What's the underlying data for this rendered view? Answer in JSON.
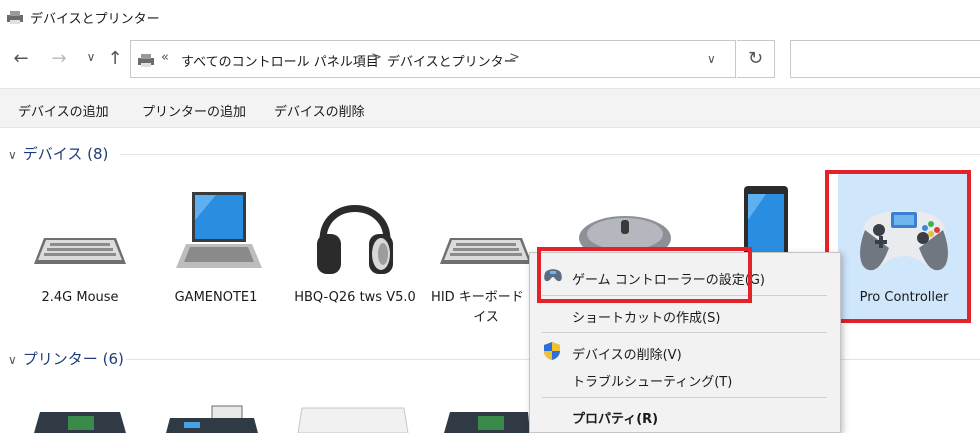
{
  "window": {
    "title": "デバイスとプリンター"
  },
  "nav": {
    "back": "←",
    "forward": "→",
    "recent": "∨",
    "up": "↑"
  },
  "address": {
    "overflow": "«",
    "crumbs": [
      "すべてのコントロール パネル項目",
      "デバイスとプリンター"
    ],
    "sep": ">",
    "dropdown": "∨",
    "refresh": "↻"
  },
  "search": {
    "placeholder": ""
  },
  "commands": [
    "デバイスの追加",
    "プリンターの追加",
    "デバイスの削除"
  ],
  "groups": {
    "devices": {
      "label": "デバイス",
      "count": "(8)"
    },
    "printers": {
      "label": "プリンター",
      "count": "(6)"
    }
  },
  "devices": [
    {
      "label": "2.4G Mouse",
      "icon": "keyboard-icon"
    },
    {
      "label": "GAMENOTE1",
      "icon": "laptop-icon"
    },
    {
      "label": "HBQ-Q26 tws V5.0",
      "icon": "headphones-icon"
    },
    {
      "label": "HID キーボード デバイス",
      "label_line1": "HID キーボード デ",
      "label_line2": "イス",
      "icon": "keyboard-icon"
    },
    {
      "label": "",
      "icon": "mouse-icon"
    },
    {
      "label": "",
      "icon": "phone-icon"
    },
    {
      "label": "Pro Controller",
      "icon": "gamepad-icon"
    }
  ],
  "context_menu": {
    "items": [
      {
        "label": "ゲーム コントローラーの設定(G)",
        "icon": "gamepad-small-icon"
      },
      {
        "label": "ショートカットの作成(S)"
      },
      {
        "label": "デバイスの削除(V)",
        "icon": "shield-icon"
      },
      {
        "label": "トラブルシューティング(T)"
      },
      {
        "label": "プロパティ(R)",
        "bold": true
      }
    ]
  },
  "colors": {
    "highlight": "#e3222a",
    "group_header": "#1f3d7a"
  }
}
